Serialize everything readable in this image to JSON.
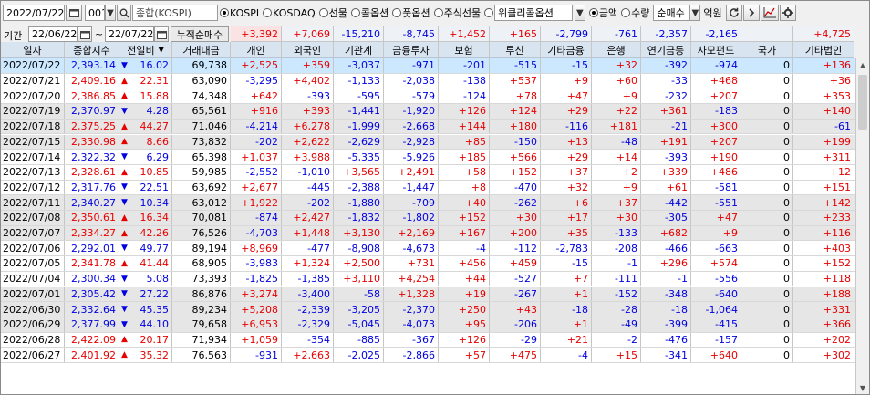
{
  "toolbar": {
    "date": "2022/07/22",
    "code": "001",
    "search_icon": "magnifier-icon",
    "index_name": "종합(KOSPI)",
    "markets": [
      "KOSPI",
      "KOSDAQ",
      "선물",
      "콜옵션",
      "풋옵션",
      "주식선물",
      "위클리콜옵션"
    ],
    "market_selected": "KOSPI",
    "amount_label": "금액",
    "qty_label": "수량",
    "amount_selected": "금액",
    "select_value": "순매수",
    "unit": "억원"
  },
  "period": {
    "label": "기간",
    "start": "22/06/22",
    "tilde": "~",
    "end": "22/07/22",
    "cum_label": "누적순매수",
    "cum_values": [
      "+3,392",
      "+7,069",
      "-15,210",
      "-8,745",
      "+1,452",
      "+165",
      "-2,799",
      "-761",
      "-2,357",
      "-2,165",
      "",
      "+4,725"
    ]
  },
  "columns": [
    "일자",
    "종합지수",
    "전일비",
    "거래대금",
    "개인",
    "외국인",
    "기관계",
    "금융투자",
    "보험",
    "투신",
    "기타금융",
    "은행",
    "연기금등",
    "사모펀드",
    "국가",
    "기타법인"
  ],
  "colors": {
    "up": "#e60000",
    "down": "#0000e0",
    "header_bg": "#d9e4f1",
    "selected_row": "#cce8ff",
    "shaded_row": "#e6e6e6"
  },
  "rows": [
    [
      "2022/07/22",
      "2,393.14",
      "dn",
      "16.02",
      "69,738",
      "+2,525",
      "+359",
      "-3,037",
      "-971",
      "-201",
      "-515",
      "-15",
      "+32",
      "-392",
      "-974",
      "0",
      "+136"
    ],
    [
      "2022/07/21",
      "2,409.16",
      "up",
      "22.31",
      "63,090",
      "-3,295",
      "+4,402",
      "-1,133",
      "-2,038",
      "-138",
      "+537",
      "+9",
      "+60",
      "-33",
      "+468",
      "0",
      "+36"
    ],
    [
      "2022/07/20",
      "2,386.85",
      "up",
      "15.88",
      "74,348",
      "+642",
      "-393",
      "-595",
      "-579",
      "-124",
      "+78",
      "+47",
      "+9",
      "-232",
      "+207",
      "0",
      "+353"
    ],
    [
      "2022/07/19",
      "2,370.97",
      "dn",
      "4.28",
      "65,561",
      "+916",
      "+393",
      "-1,441",
      "-1,920",
      "+126",
      "+124",
      "+29",
      "+22",
      "+361",
      "-183",
      "0",
      "+140"
    ],
    [
      "2022/07/18",
      "2,375.25",
      "up",
      "44.27",
      "71,046",
      "-4,214",
      "+6,278",
      "-1,999",
      "-2,668",
      "+144",
      "+180",
      "-116",
      "+181",
      "-21",
      "+300",
      "0",
      "-61"
    ],
    [
      "2022/07/15",
      "2,330.98",
      "up",
      "8.66",
      "73,832",
      "-202",
      "+2,622",
      "-2,629",
      "-2,928",
      "+85",
      "-150",
      "+13",
      "-48",
      "+191",
      "+207",
      "0",
      "+199"
    ],
    [
      "2022/07/14",
      "2,322.32",
      "dn",
      "6.29",
      "65,398",
      "+1,037",
      "+3,988",
      "-5,335",
      "-5,926",
      "+185",
      "+566",
      "+29",
      "+14",
      "-393",
      "+190",
      "0",
      "+311"
    ],
    [
      "2022/07/13",
      "2,328.61",
      "up",
      "10.85",
      "59,985",
      "-2,552",
      "-1,010",
      "+3,565",
      "+2,491",
      "+58",
      "+152",
      "+37",
      "+2",
      "+339",
      "+486",
      "0",
      "+12"
    ],
    [
      "2022/07/12",
      "2,317.76",
      "dn",
      "22.51",
      "63,692",
      "+2,677",
      "-445",
      "-2,388",
      "-1,447",
      "+8",
      "-470",
      "+32",
      "+9",
      "+61",
      "-581",
      "0",
      "+151"
    ],
    [
      "2022/07/11",
      "2,340.27",
      "dn",
      "10.34",
      "63,012",
      "+1,922",
      "-202",
      "-1,880",
      "-709",
      "+40",
      "-262",
      "+6",
      "+37",
      "-442",
      "-551",
      "0",
      "+142"
    ],
    [
      "2022/07/08",
      "2,350.61",
      "up",
      "16.34",
      "70,081",
      "-874",
      "+2,427",
      "-1,832",
      "-1,802",
      "+152",
      "+30",
      "+17",
      "+30",
      "-305",
      "+47",
      "0",
      "+233"
    ],
    [
      "2022/07/07",
      "2,334.27",
      "up",
      "42.26",
      "76,526",
      "-4,703",
      "+1,448",
      "+3,130",
      "+2,169",
      "+167",
      "+200",
      "+35",
      "-133",
      "+682",
      "+9",
      "0",
      "+116"
    ],
    [
      "2022/07/06",
      "2,292.01",
      "dn",
      "49.77",
      "89,194",
      "+8,969",
      "-477",
      "-8,908",
      "-4,673",
      "-4",
      "-112",
      "-2,783",
      "-208",
      "-466",
      "-663",
      "0",
      "+403"
    ],
    [
      "2022/07/05",
      "2,341.78",
      "up",
      "41.44",
      "68,905",
      "-3,983",
      "+1,324",
      "+2,500",
      "+731",
      "+456",
      "+459",
      "-15",
      "-1",
      "+296",
      "+574",
      "0",
      "+152"
    ],
    [
      "2022/07/04",
      "2,300.34",
      "dn",
      "5.08",
      "73,393",
      "-1,825",
      "-1,385",
      "+3,110",
      "+4,254",
      "+44",
      "-527",
      "+7",
      "-111",
      "-1",
      "-556",
      "0",
      "+118"
    ],
    [
      "2022/07/01",
      "2,305.42",
      "dn",
      "27.22",
      "86,876",
      "+3,274",
      "-3,400",
      "-58",
      "+1,328",
      "+19",
      "-267",
      "+1",
      "-152",
      "-348",
      "-640",
      "0",
      "+188"
    ],
    [
      "2022/06/30",
      "2,332.64",
      "dn",
      "45.35",
      "89,234",
      "+5,208",
      "-2,339",
      "-3,205",
      "-2,370",
      "+250",
      "+43",
      "-18",
      "-28",
      "-18",
      "-1,064",
      "0",
      "+331"
    ],
    [
      "2022/06/29",
      "2,377.99",
      "dn",
      "44.10",
      "79,658",
      "+6,953",
      "-2,329",
      "-5,045",
      "-4,073",
      "+95",
      "-206",
      "+1",
      "-49",
      "-399",
      "-415",
      "0",
      "+366"
    ],
    [
      "2022/06/28",
      "2,422.09",
      "up",
      "20.17",
      "71,934",
      "+1,059",
      "-354",
      "-885",
      "-367",
      "+126",
      "-29",
      "+21",
      "-2",
      "-476",
      "-157",
      "0",
      "+202"
    ],
    [
      "2022/06/27",
      "2,401.92",
      "up",
      "35.32",
      "76,563",
      "-931",
      "+2,663",
      "-2,025",
      "-2,866",
      "+57",
      "+475",
      "-4",
      "+15",
      "-341",
      "+640",
      "0",
      "+302"
    ]
  ]
}
